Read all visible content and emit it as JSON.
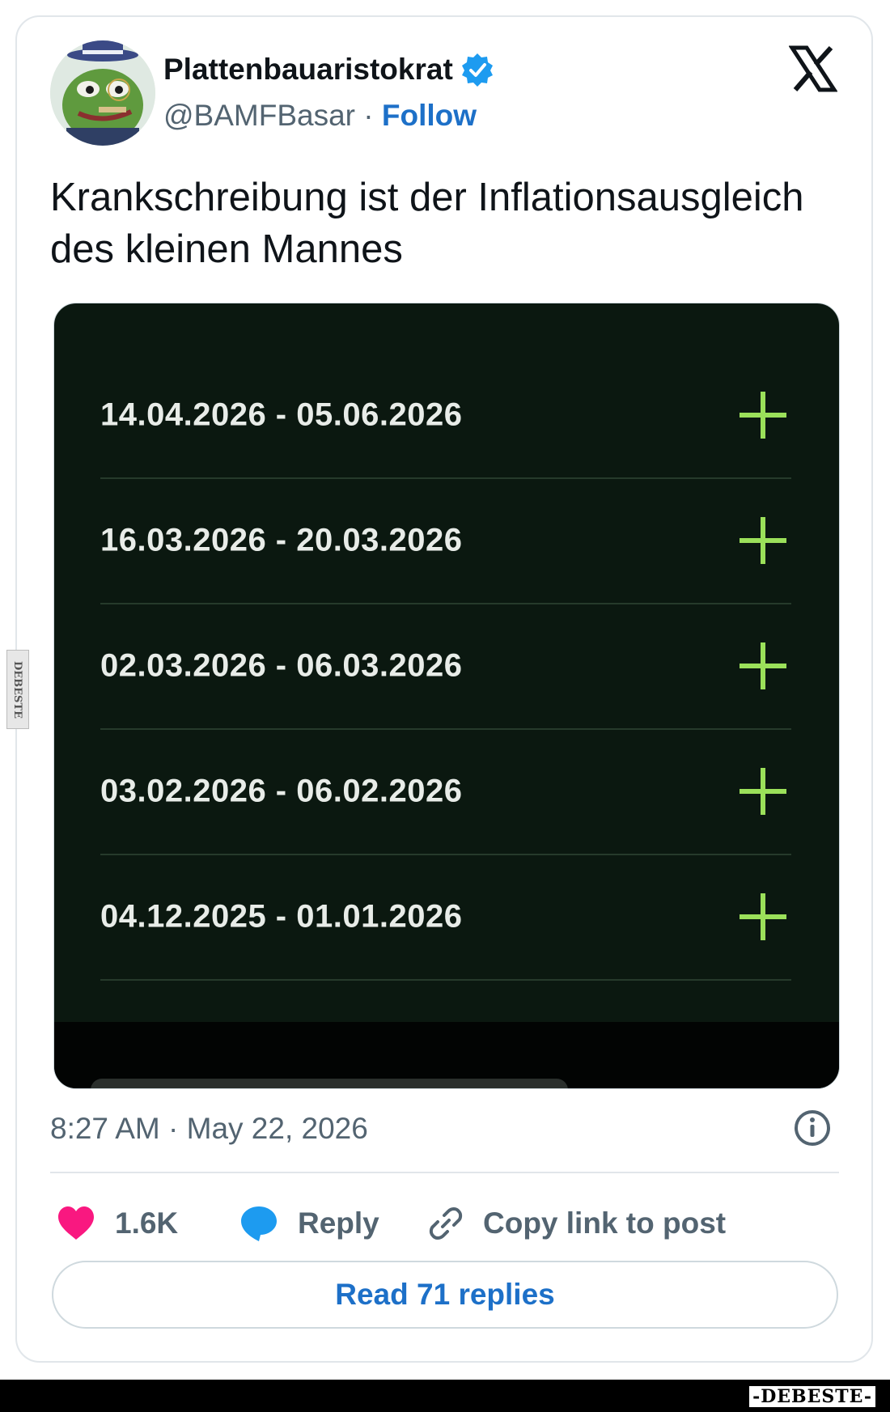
{
  "tweet": {
    "display_name": "Plattenbauaristokrat",
    "handle": "@BAMFBasar",
    "separator": " · ",
    "follow_label": "Follow",
    "text": "Krankschreibung ist der Inflationsausgleich des kleinen Mannes",
    "timestamp": "8:27 AM · May 22, 2026"
  },
  "media": {
    "rows": [
      {
        "dates": "14.04.2026 - 05.06.2026"
      },
      {
        "dates": "16.03.2026 - 20.03.2026"
      },
      {
        "dates": "02.03.2026 - 06.03.2026"
      },
      {
        "dates": "03.02.2026 - 06.02.2026"
      },
      {
        "dates": "04.12.2025 - 01.01.2026"
      }
    ]
  },
  "actions": {
    "likes": "1.6K",
    "reply": "Reply",
    "copy_link": "Copy link to post",
    "read_replies": "Read 71 replies"
  },
  "watermark": {
    "side": "DEBESTE",
    "footer": "-DEBESTE-"
  },
  "colors": {
    "accent": "#1d70c8",
    "heart": "#f91880",
    "reply_bubble": "#1d9bf0",
    "plus": "#9be05a",
    "media_bg": "#0b1810"
  },
  "icons": [
    "x-logo-icon",
    "verified-badge-icon",
    "info-icon",
    "heart-icon",
    "reply-icon",
    "link-icon",
    "plus-icon"
  ]
}
